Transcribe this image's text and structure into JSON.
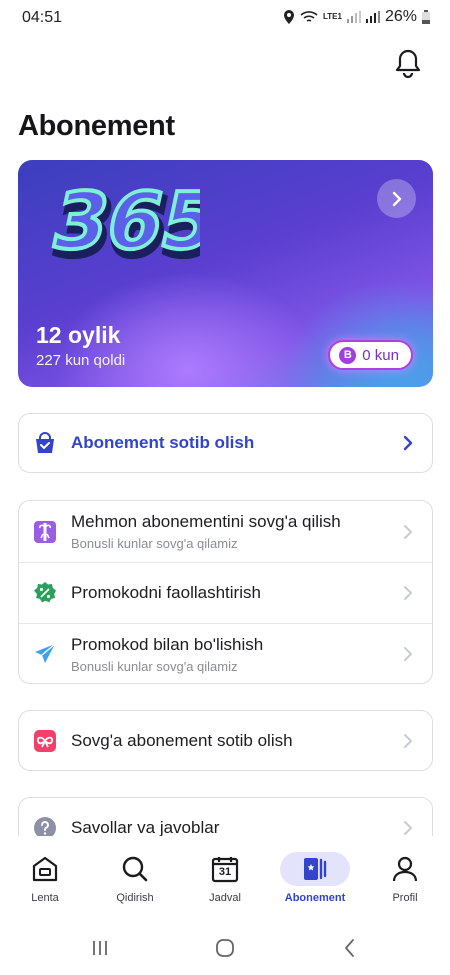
{
  "status_bar": {
    "time": "04:51",
    "battery": "26%",
    "network": "LTE1"
  },
  "header": {
    "title": "Abonement"
  },
  "subscription_card": {
    "logo_text": "365",
    "plan": "12 oylik",
    "remaining": "227 kun qoldi",
    "bonus_badge": "B",
    "bonus_days": "0 kun"
  },
  "buy_card": {
    "label": "Abonement sotib olish"
  },
  "gift_list": [
    {
      "title": "Mehmon abonementini sovg'a qilish",
      "subtitle": "Bonusli kunlar sovg'a qilamiz"
    },
    {
      "title": "Promokodni faollashtirish",
      "subtitle": ""
    },
    {
      "title": "Promokod bilan bo'lishish",
      "subtitle": "Bonusli kunlar sovg'a qilamiz"
    }
  ],
  "gift_buy": {
    "title": "Sovg'a abonement sotib olish"
  },
  "faq": {
    "title": "Savollar va javoblar"
  },
  "bottom_nav": [
    {
      "label": "Lenta",
      "icon": "home-icon"
    },
    {
      "label": "Qidirish",
      "icon": "search-icon"
    },
    {
      "label": "Jadval",
      "icon": "calendar-icon",
      "badge": "31"
    },
    {
      "label": "Abonement",
      "icon": "subscription-icon",
      "active": true
    },
    {
      "label": "Profil",
      "icon": "profile-icon"
    }
  ],
  "colors": {
    "accent": "#3244c9",
    "bonus": "#a13fe0",
    "gift_red": "#f0416b",
    "green": "#2aa05a",
    "sky": "#3aa0f0"
  }
}
